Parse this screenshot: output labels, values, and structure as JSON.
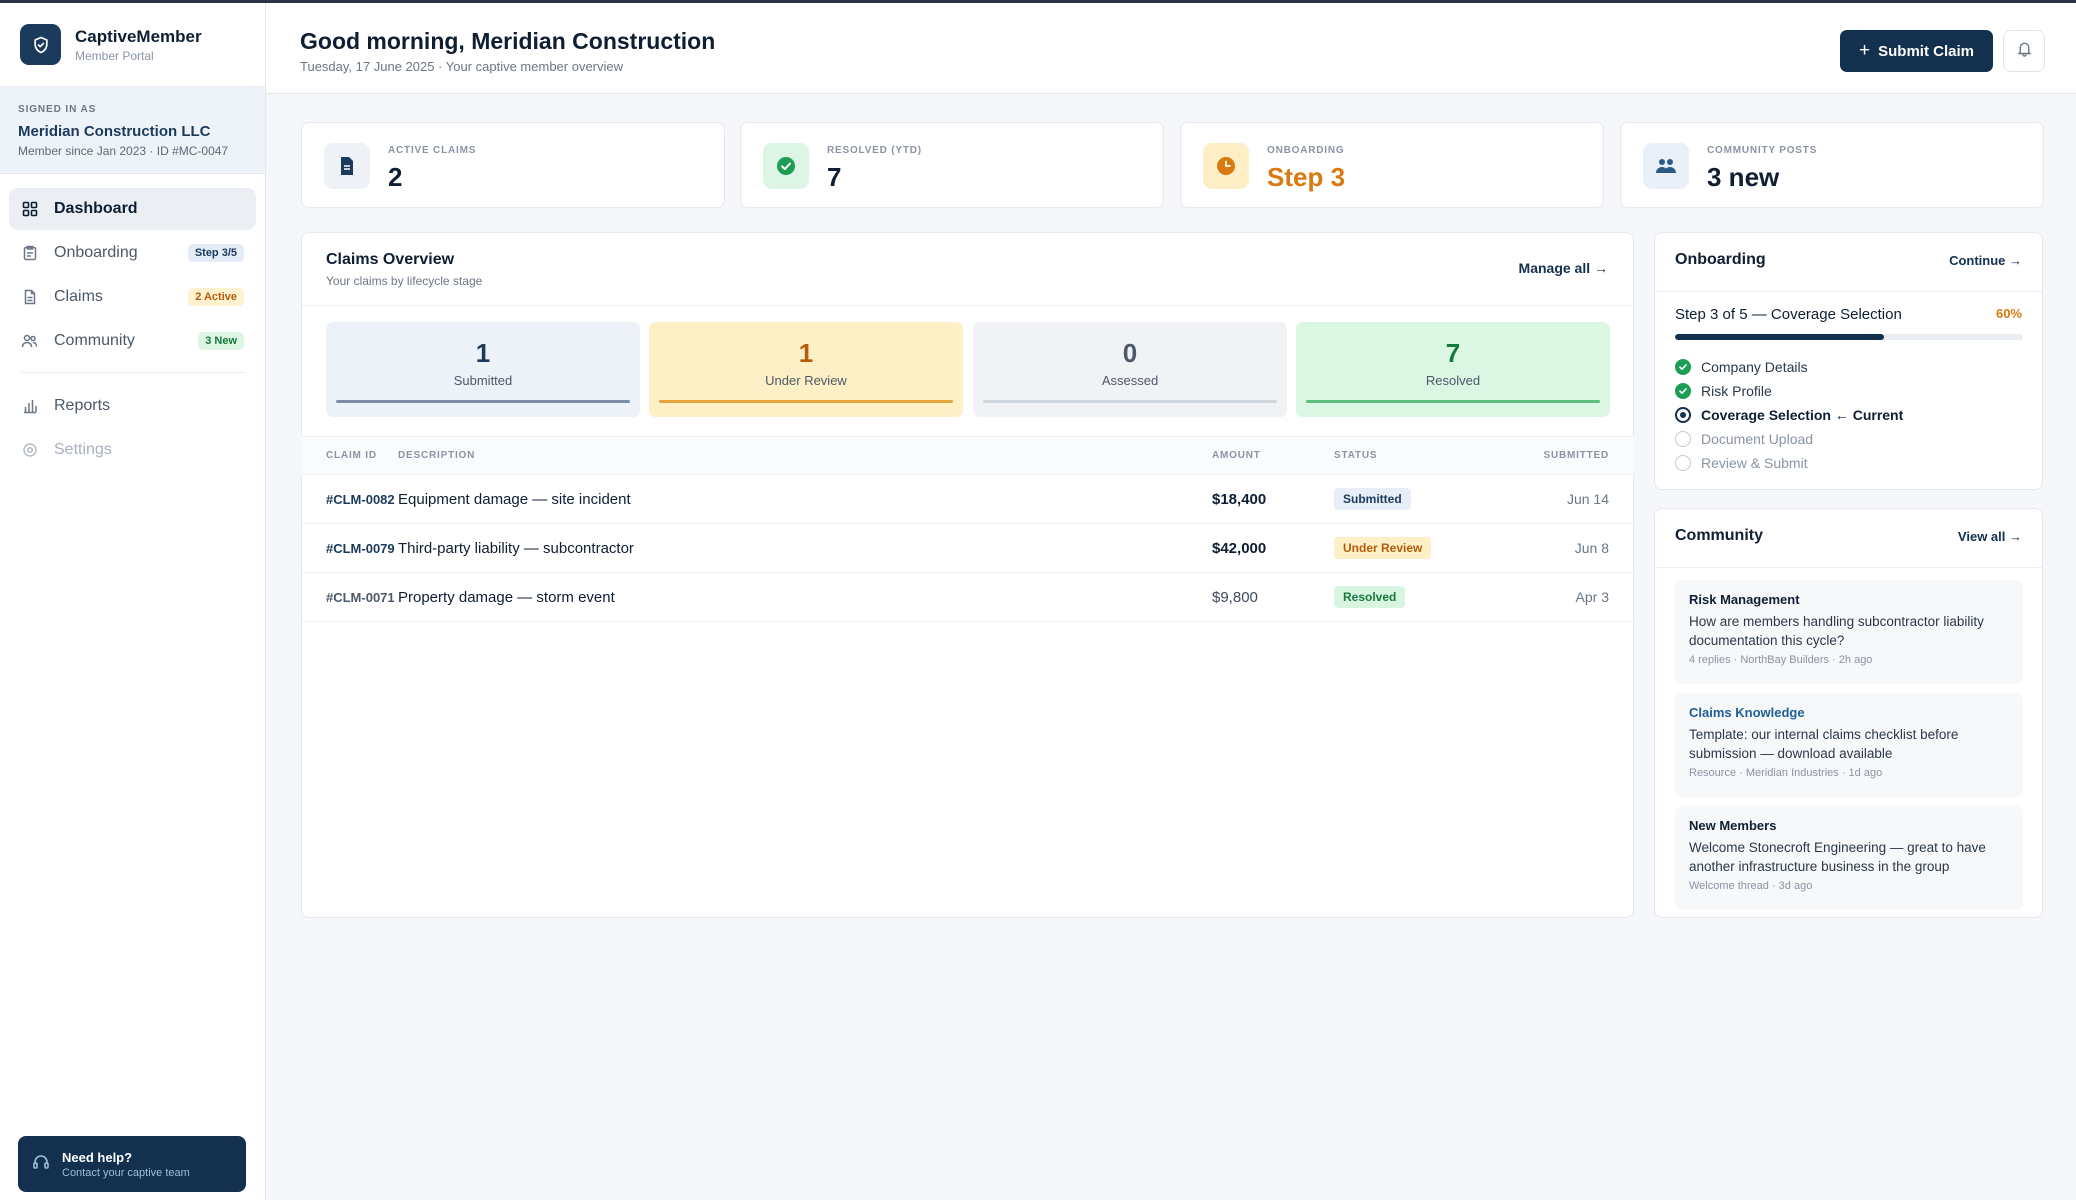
{
  "brand": {
    "name": "CaptiveMember",
    "subtitle": "Member Portal"
  },
  "account": {
    "label": "SIGNED IN AS",
    "name": "Meridian Construction LLC",
    "meta": "Member since Jan 2023 · ID #MC-0047"
  },
  "nav": {
    "items": [
      {
        "label": "Dashboard",
        "icon": "grid-icon",
        "active": true
      },
      {
        "label": "Onboarding",
        "icon": "clipboard-icon",
        "badge": "Step 3/5"
      },
      {
        "label": "Claims",
        "icon": "document-icon",
        "badge": "2 Active"
      },
      {
        "label": "Community",
        "icon": "users-icon",
        "badge": "3 New"
      },
      {
        "label": "Reports",
        "icon": "bar-chart-icon"
      },
      {
        "label": "Settings",
        "icon": "gear-icon",
        "disabled": true
      }
    ]
  },
  "help": {
    "title": "Need help?",
    "subtitle": "Contact your captive team"
  },
  "header": {
    "greeting": "Good morning, Meridian Construction",
    "date": "Tuesday, 17 June 2025 · Your captive member overview",
    "submit_label": "Submit Claim"
  },
  "stats": [
    {
      "label": "ACTIVE CLAIMS",
      "value": "2",
      "icon": "document-icon",
      "color": "#1b3a5c"
    },
    {
      "label": "RESOLVED (YTD)",
      "value": "7",
      "icon": "check-circle-icon",
      "color": "#1f9d55"
    },
    {
      "label": "ONBOARDING",
      "value": "Step 3",
      "icon": "clock-icon",
      "color": "#d87a10"
    },
    {
      "label": "COMMUNITY POSTS",
      "value": "3 new",
      "icon": "users-icon",
      "color": "#2b5a8a"
    }
  ],
  "claims_overview": {
    "title": "Claims Overview",
    "subtitle": "Your claims by lifecycle stage",
    "manage_label": "Manage all →",
    "stages": [
      {
        "count": "1",
        "label": "Submitted"
      },
      {
        "count": "1",
        "label": "Under Review"
      },
      {
        "count": "0",
        "label": "Assessed"
      },
      {
        "count": "7",
        "label": "Resolved"
      }
    ],
    "columns": [
      "CLAIM ID",
      "DESCRIPTION",
      "AMOUNT",
      "STATUS",
      "SUBMITTED"
    ],
    "rows": [
      {
        "id": "#CLM-0082",
        "description": "Equipment damage — site incident",
        "amount": "$18,400",
        "status": "Submitted",
        "submitted": "Jun 14"
      },
      {
        "id": "#CLM-0079",
        "description": "Third-party liability — subcontractor",
        "amount": "$42,000",
        "status": "Under Review",
        "submitted": "Jun 8"
      },
      {
        "id": "#CLM-0071",
        "description": "Property damage — storm event",
        "amount": "$9,800",
        "status": "Resolved",
        "submitted": "Apr 3"
      }
    ]
  },
  "onboarding": {
    "title": "Onboarding",
    "continue_label": "Continue →",
    "step_title": "Step 3 of 5 — Coverage Selection",
    "percent": "60%",
    "progress": 0.6,
    "steps": [
      {
        "label": "Company Details",
        "state": "done"
      },
      {
        "label": "Risk Profile",
        "state": "done"
      },
      {
        "label": "Coverage Selection ← Current",
        "state": "current"
      },
      {
        "label": "Document Upload",
        "state": "todo"
      },
      {
        "label": "Review & Submit",
        "state": "todo"
      }
    ]
  },
  "community": {
    "title": "Community",
    "view_all_label": "View all →",
    "posts": [
      {
        "category": "Risk Management",
        "text": "How are members handling subcontractor liability documentation this cycle?",
        "meta": "4 replies · NorthBay Builders · 2h ago"
      },
      {
        "category": "Claims Knowledge",
        "text": "Template: our internal claims checklist before submission — download available",
        "meta": "Resource · Meridian Industries · 1d ago"
      },
      {
        "category": "New Members",
        "text": "Welcome Stonecroft Engineering — great to have another infrastructure business in the group",
        "meta": "Welcome thread · 3d ago"
      }
    ]
  }
}
